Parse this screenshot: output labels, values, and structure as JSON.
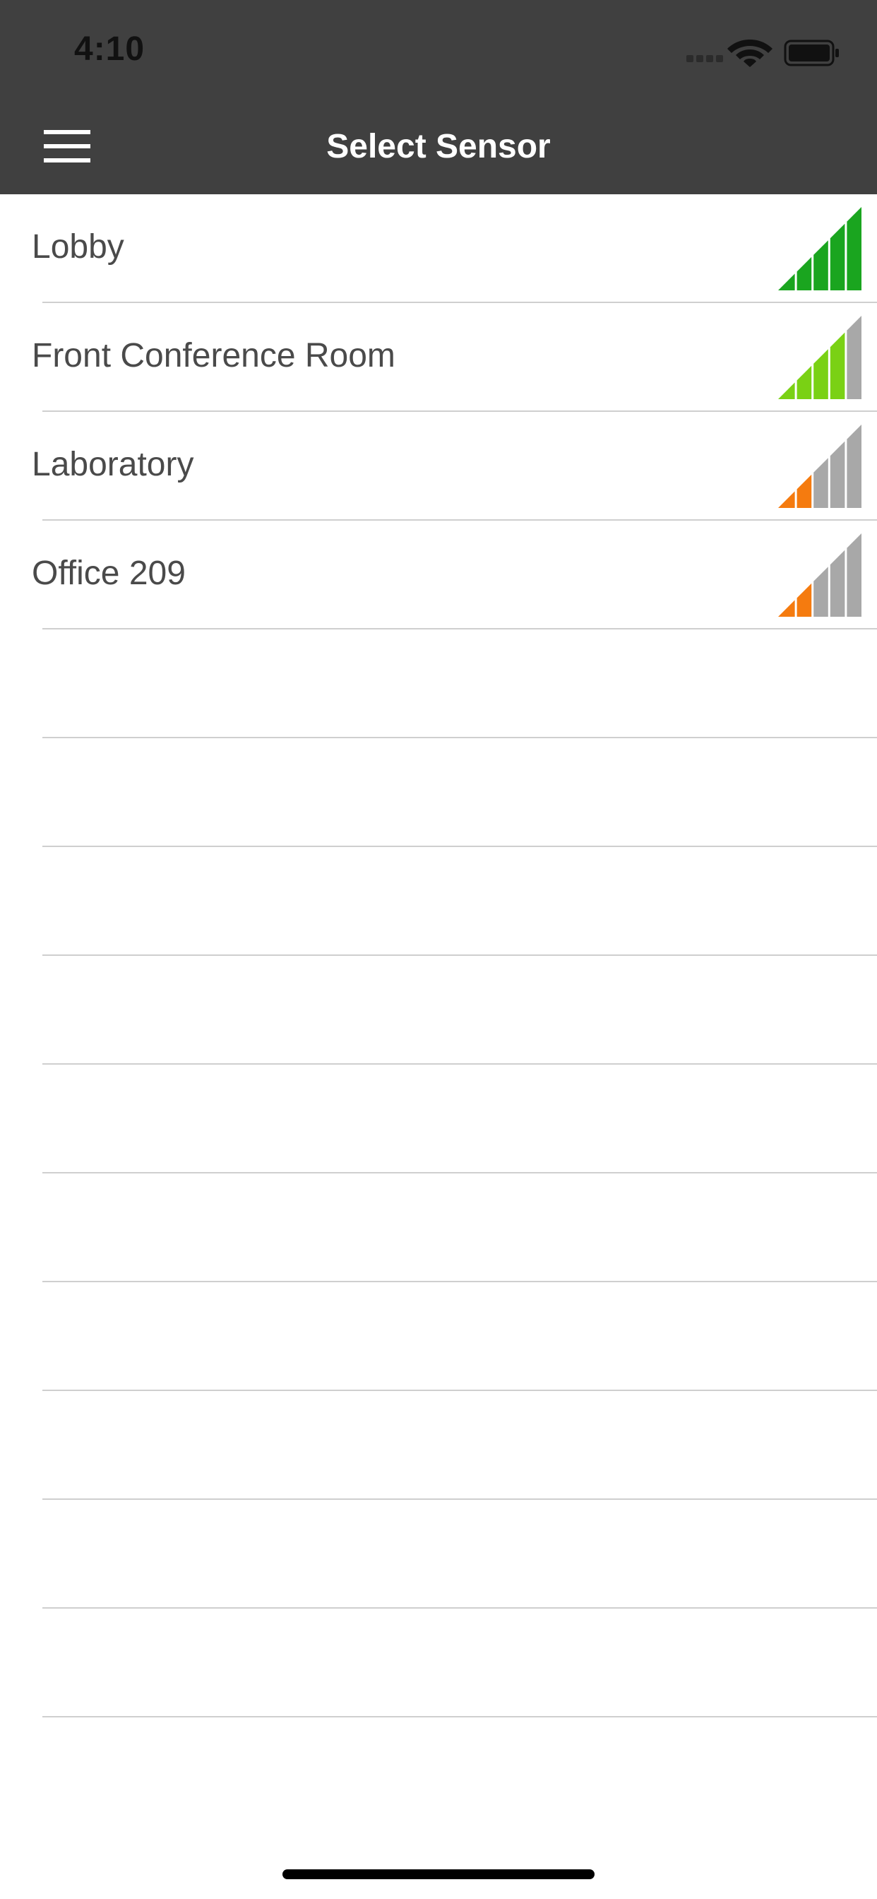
{
  "status_bar": {
    "time": "4:10",
    "icons": [
      "cellular-signal-icon",
      "wifi-icon",
      "battery-icon"
    ]
  },
  "nav_bar": {
    "title": "Select Sensor",
    "menu_icon": "hamburger-menu-icon"
  },
  "sensors": [
    {
      "name": "Lobby",
      "signal_level": 5,
      "signal_max": 5,
      "signal_color": "#1aa51f"
    },
    {
      "name": "Front Conference Room",
      "signal_level": 4,
      "signal_max": 5,
      "signal_color": "#7ad114"
    },
    {
      "name": "Laboratory",
      "signal_level": 2,
      "signal_max": 5,
      "signal_color": "#f57b0f"
    },
    {
      "name": "Office 209",
      "signal_level": 2,
      "signal_max": 5,
      "signal_color": "#f57b0f"
    }
  ],
  "empty_row_count": 10,
  "colors": {
    "header_background": "#404040",
    "header_text": "#ffffff",
    "row_text": "#4a4a4a",
    "separator": "#cfcfcf",
    "signal_inactive": "#a8a8a8"
  }
}
